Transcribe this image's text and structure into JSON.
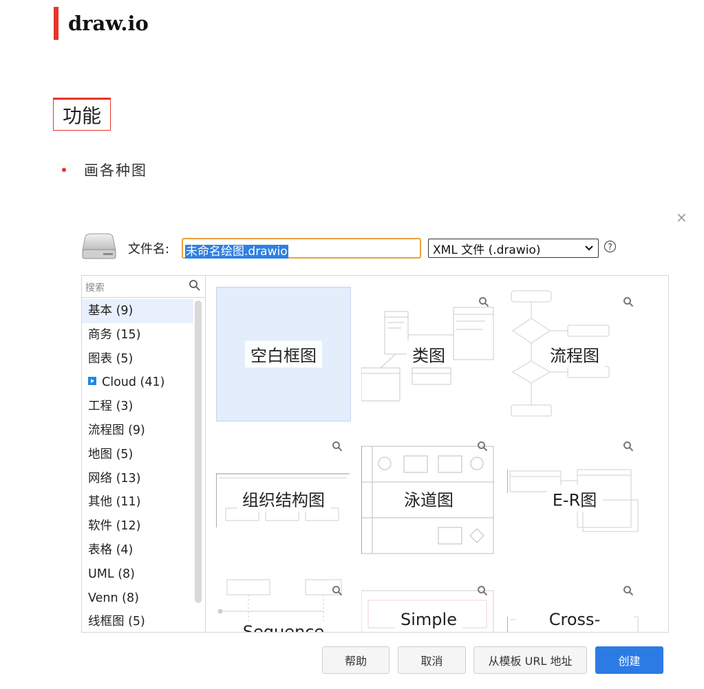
{
  "article": {
    "title": "draw.io",
    "section": "功能",
    "bullet": "画各种图"
  },
  "dialog": {
    "close_symbol": "×",
    "filename_label": "文件名:",
    "filename_value": "未命名绘图.drawio",
    "format_value": "XML 文件 (.drawio)",
    "format_chevron": "⌄",
    "help_symbol": "?",
    "search_placeholder": "搜索",
    "categories": [
      {
        "label": "基本 (9)",
        "active": true
      },
      {
        "label": "商务 (15)"
      },
      {
        "label": "图表 (5)"
      },
      {
        "label": "Cloud (41)",
        "icon": "cloud-play-icon"
      },
      {
        "label": "工程 (3)"
      },
      {
        "label": "流程图 (9)"
      },
      {
        "label": "地图 (5)"
      },
      {
        "label": "网络 (13)"
      },
      {
        "label": "其他 (11)"
      },
      {
        "label": "软件 (12)"
      },
      {
        "label": "表格 (4)"
      },
      {
        "label": "UML (8)"
      },
      {
        "label": "Venn (8)"
      },
      {
        "label": "线框图 (5)"
      }
    ],
    "templates": [
      {
        "label": "空白框图",
        "selected": true
      },
      {
        "label": "类图"
      },
      {
        "label": "流程图"
      },
      {
        "label": "组织结构图"
      },
      {
        "label": "泳道图"
      },
      {
        "label": "E-R图"
      },
      {
        "label": "Sequence"
      },
      {
        "label": "Simple"
      },
      {
        "label": "Cross-"
      }
    ],
    "buttons": {
      "help": "帮助",
      "cancel": "取消",
      "from_url": "从模板 URL 地址",
      "create": "创建"
    }
  },
  "colors": {
    "accent_red": "#e53527",
    "primary_blue": "#2c7be5",
    "selection_blue": "#2f80e0",
    "input_focus_orange": "#e8a33b"
  }
}
